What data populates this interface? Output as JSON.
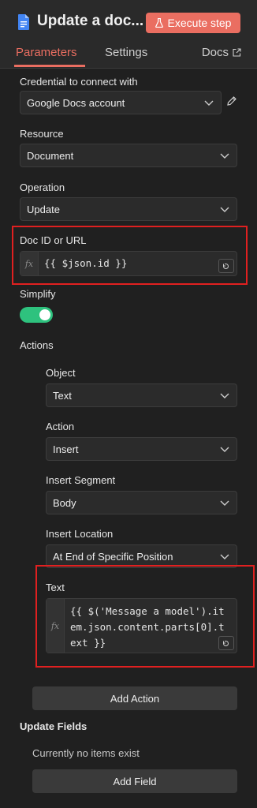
{
  "header": {
    "title": "Update a doc...",
    "execute_label": "Execute step",
    "node_icon": "google-docs-icon",
    "flask_icon": "flask-icon"
  },
  "tabs": {
    "parameters": "Parameters",
    "settings": "Settings",
    "docs": "Docs",
    "docs_icon": "external-link-icon"
  },
  "form": {
    "credential_label": "Credential to connect with",
    "credential_value": "Google Docs account",
    "resource_label": "Resource",
    "resource_value": "Document",
    "operation_label": "Operation",
    "operation_value": "Update",
    "docid_label": "Doc ID or URL",
    "docid_value": "{{ $json.id }}",
    "simplify_label": "Simplify",
    "simplify_on": true,
    "actions_label": "Actions",
    "object_label": "Object",
    "object_value": "Text",
    "action_label": "Action",
    "action_value": "Insert",
    "segment_label": "Insert Segment",
    "segment_value": "Body",
    "location_label": "Insert Location",
    "location_value": "At End of Specific Position",
    "text_label": "Text",
    "text_value": "{{ $('Message a model').item.json.content.parts[0].text }}",
    "add_action": "Add Action",
    "update_fields_label": "Update Fields",
    "no_items": "Currently no items exist",
    "add_field": "Add Field"
  },
  "colors": {
    "accent": "#ea6e61",
    "toggle_on": "#2ec27e",
    "highlight": "#e02020"
  }
}
